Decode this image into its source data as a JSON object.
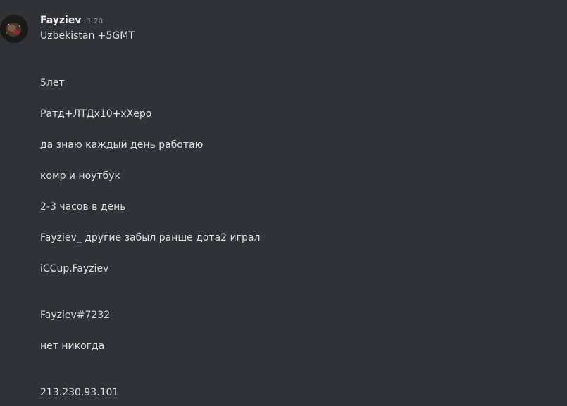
{
  "message": {
    "avatar_icon": "user-avatar-icon",
    "username": "Fayziev",
    "timestamp": "1:20",
    "lines": [
      "Uzbekistan +5GMT",
      "5лет",
      "Ратд+ЛТДх10+хХеро",
      "да знаю каждый день работаю",
      "комр и ноутбук",
      "2-3 часов в день",
      "Fayziev_ другие забыл ранше дота2 играл",
      "iCCup.Fayziev",
      "Fayziev#7232",
      "нет никогда",
      "213.230.93.101"
    ]
  },
  "colors": {
    "background": "#323339",
    "username": "#f2f3f5",
    "text": "#dbdee1",
    "timestamp": "#949ba4"
  }
}
